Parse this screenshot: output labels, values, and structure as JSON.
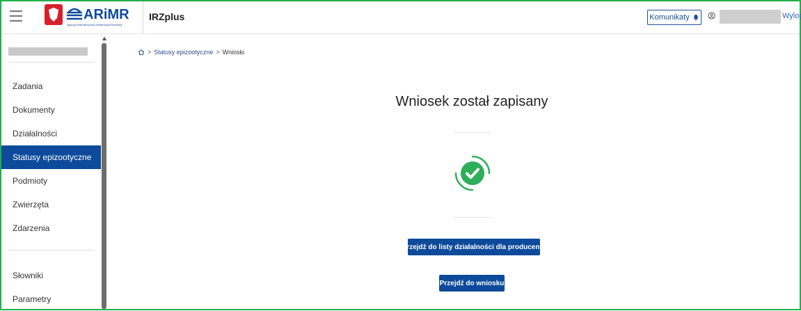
{
  "header": {
    "logo_text": "ARiMR",
    "logo_subtext": "Agencja Restrukturyzacji i Modernizacji Rolnictwa",
    "app_title": "IRZplus",
    "komunikaty_label": "Komunikaty",
    "logout_label": "Wylogu"
  },
  "sidebar": {
    "items": [
      {
        "label": "Zadania"
      },
      {
        "label": "Dokumenty"
      },
      {
        "label": "Działalności"
      },
      {
        "label": "Statusy epizootyczne",
        "active": true
      },
      {
        "label": "Podmioty"
      },
      {
        "label": "Zwierzęta"
      },
      {
        "label": "Zdarzenia"
      },
      {
        "label": "Słowniki"
      },
      {
        "label": "Parametry"
      }
    ]
  },
  "breadcrumb": {
    "items": [
      "Statusy epizootyczne",
      "Wnioski"
    ]
  },
  "main": {
    "title": "Wniosek został zapisany",
    "button_list": "Przejdź do listy działalności dla producenta",
    "button_wniosek": "Przejdź do wniosku"
  },
  "colors": {
    "primary": "#0d4a9b",
    "success": "#2fae5a",
    "frame": "#1fb04a"
  },
  "icons": [
    "menu-icon",
    "bell-icon",
    "user-icon",
    "home-icon",
    "check-circle-icon"
  ]
}
